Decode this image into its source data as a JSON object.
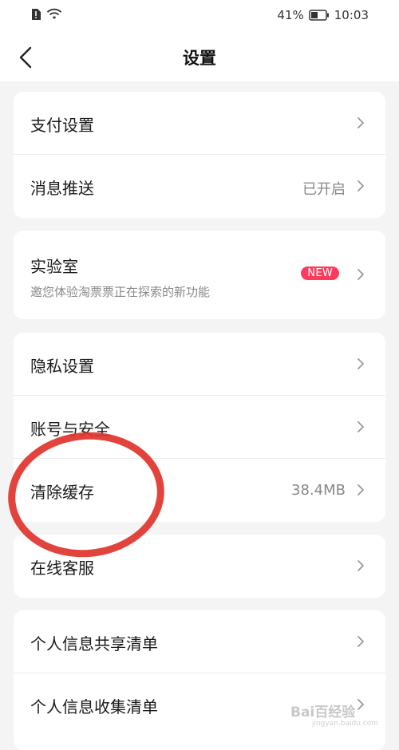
{
  "status_bar": {
    "battery": "41%",
    "time": "10:03"
  },
  "header": {
    "title": "设置"
  },
  "sections": {
    "payment": {
      "label": "支付设置"
    },
    "notifications": {
      "label": "消息推送",
      "value": "已开启"
    },
    "lab": {
      "label": "实验室",
      "subtitle": "邀您体验淘票票正在探索的新功能",
      "badge": "NEW"
    },
    "privacy": {
      "label": "隐私设置"
    },
    "account": {
      "label": "账号与安全"
    },
    "cache": {
      "label": "清除缓存",
      "value": "38.4MB"
    },
    "support": {
      "label": "在线客服"
    },
    "info_share": {
      "label": "个人信息共享清单"
    },
    "info_collect": {
      "label": "个人信息收集清单"
    }
  },
  "watermark": {
    "text": "Bai百经验",
    "sub": "jingyan.baidu.com"
  },
  "colors": {
    "accent": "#ff3a5c",
    "annotation": "#e0342c"
  }
}
